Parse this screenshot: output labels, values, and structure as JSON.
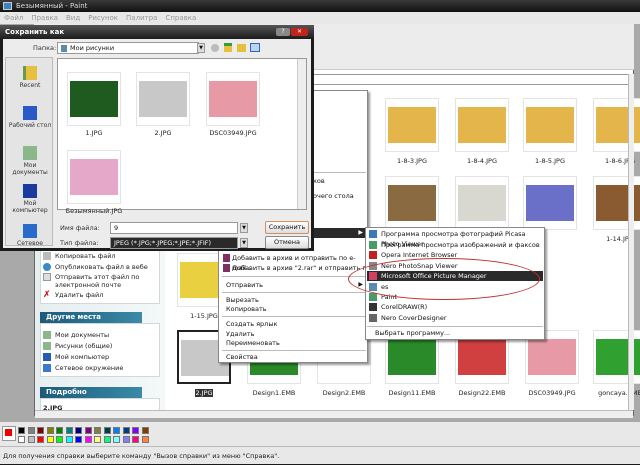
{
  "paint": {
    "title": "Безымянный - Paint",
    "menu": [
      "Файл",
      "Правка",
      "Вид",
      "Рисунок",
      "Палитра",
      "Справка"
    ],
    "status": "Для получения справки выберите команду \"Вызов справки\" из меню \"Справка\".",
    "primary_color": "#e00000",
    "secondary_color": "#ffffff",
    "palette_row1": [
      "#000000",
      "#808080",
      "#800000",
      "#808000",
      "#008000",
      "#008080",
      "#000080",
      "#800080",
      "#808040",
      "#004040",
      "#0080ff",
      "#004080",
      "#8000ff",
      "#804000"
    ],
    "palette_row2": [
      "#ffffff",
      "#c0c0c0",
      "#ff0000",
      "#ffff00",
      "#00ff00",
      "#00ffff",
      "#0000ff",
      "#ff00ff",
      "#ffff80",
      "#00ff80",
      "#80ffff",
      "#8080ff",
      "#ff0080",
      "#ff8040"
    ]
  },
  "dialog": {
    "title": "Сохранить как",
    "help": "?",
    "close": "✕",
    "folder_label": "Папка:",
    "folder_value": "Мои рисунки",
    "places": [
      "Recent",
      "Рабочий стол",
      "Мои документы",
      "Мой компьютер",
      "Сетевое"
    ],
    "files": [
      {
        "name": "1.JPG",
        "color": "#1f5a1f"
      },
      {
        "name": "2.JPG",
        "color": "#c8c8c8"
      },
      {
        "name": "DSC03949.JPG",
        "color": "#e79aa6"
      },
      {
        "name": "Безымянный.JPG",
        "color": "#e6a8c8"
      }
    ],
    "filename_label": "Имя файла:",
    "filename_value": "9",
    "filetype_label": "Тип файла:",
    "filetype_value": "JPEG (*.JPG;*.JPEG;*.JPE;*.JFIF)",
    "save_button": "Сохранить",
    "cancel_button": "Отмена"
  },
  "explorer": {
    "tasks": [
      "Копировать файл",
      "Опубликовать файл в вебе",
      "Отправить этот файл по электронной почте",
      "Удалить файл"
    ],
    "other_places_header": "Другие места",
    "other_places": [
      "Мои документы",
      "Рисунки (общие)",
      "Мой компьютер",
      "Сетевое окружение"
    ],
    "details_header": "Подробно",
    "details_name": "2.JPG",
    "thumbs": [
      {
        "name": "1-8-3.JPG",
        "color": "#e3b54a"
      },
      {
        "name": "1-8-4.JPG",
        "color": "#e3b54a"
      },
      {
        "name": "1-8-5.JPG",
        "color": "#e3b54a"
      },
      {
        "name": "1-8-6.JPG",
        "color": "#e3b54a"
      },
      {
        "name": "",
        "color": "#8a6a40"
      },
      {
        "name": "",
        "color": "#d8d8d0"
      },
      {
        "name": "",
        "color": "#6a70c8"
      },
      {
        "name": "1-14.JPG",
        "color": "#8a5a30"
      },
      {
        "name": "1-15.JPG",
        "color": "#e8d040"
      },
      {
        "name": "2.JPG",
        "color": "#c8c8c8"
      },
      {
        "name": "Design1.EMB",
        "color": "#2a8a2a"
      },
      {
        "name": "Design2.EMB",
        "color": "#ffffff"
      },
      {
        "name": "Design11.EMB",
        "color": "#2a8a2a"
      },
      {
        "name": "Design22.EMB",
        "color": "#d04040"
      },
      {
        "name": "DSC03949.JPG",
        "color": "#e79aa6"
      },
      {
        "name": "goncaya.EMB",
        "color": "#30a030"
      }
    ]
  },
  "context_menu": {
    "partial1": "ков",
    "partial2": "очего стола",
    "add_archive_email": "Добавить в архив и отправить по e-mail...",
    "add_rar_email": "Добавить в архив \"2.rar\" и отправить по e-mail",
    "send_to": "Отправить",
    "cut": "Вырезать",
    "copy": "Копировать",
    "shortcut": "Создать ярлык",
    "delete": "Удалить",
    "rename": "Переименовать",
    "properties": "Свойства"
  },
  "open_with": {
    "items": [
      {
        "label": "Программа просмотра фотографий Picasa Photo Viewer",
        "icon": "#3a7ab8"
      },
      {
        "label": "Программа просмотра изображений и факсов",
        "icon": "#4a9a6a"
      },
      {
        "label": "Opera Internet Browser",
        "icon": "#c02020"
      },
      {
        "label": "Nero PhotoSnap Viewer",
        "icon": "#888888"
      },
      {
        "label": "Microsoft Office Picture Manager",
        "icon": "#d04060"
      },
      {
        "label": "es",
        "icon": "#5a8ab0"
      },
      {
        "label": "Paint",
        "icon": "#4a9a6a"
      },
      {
        "label": "CorelDRAW(R)",
        "icon": "#333333"
      },
      {
        "label": "Nero CoverDesigner",
        "icon": "#666666"
      }
    ],
    "choose": "Выбрать программу...",
    "highlight_color": "#2a2a2a",
    "annotation_color": "#c03030"
  }
}
